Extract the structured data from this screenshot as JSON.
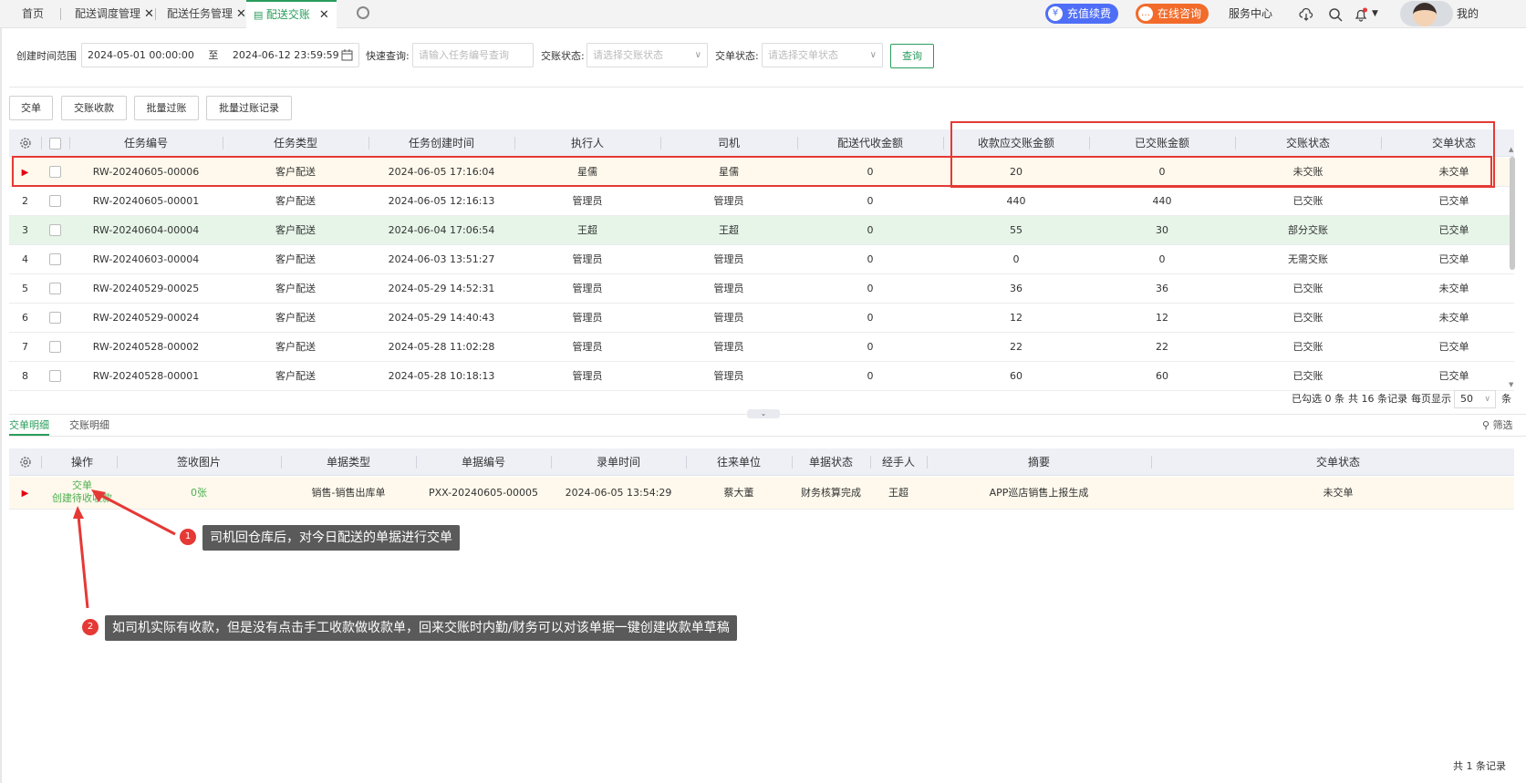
{
  "tabs": [
    {
      "label": "首页"
    },
    {
      "label": "配送调度管理"
    },
    {
      "label": "配送任务管理"
    },
    {
      "label": "配送交账"
    }
  ],
  "header": {
    "recharge": "充值续费",
    "consult": "在线咨询",
    "service": "服务中心",
    "user": "我的"
  },
  "filters": {
    "date_label": "创建时间范围",
    "date_start": "2024-05-01 00:00:00",
    "date_to": "至",
    "date_end": "2024-06-12 23:59:59",
    "quick_label": "快速查询:",
    "quick_placeholder": "请输入任务编号查询",
    "account_status_label": "交账状态:",
    "account_status_placeholder": "请选择交账状态",
    "order_status_label": "交单状态:",
    "order_status_placeholder": "请选择交单状态",
    "query": "查询"
  },
  "actions": [
    "交单",
    "交账收款",
    "批量过账",
    "批量过账记录"
  ],
  "table": {
    "columns": [
      "任务编号",
      "任务类型",
      "任务创建时间",
      "执行人",
      "司机",
      "配送代收金额",
      "收款应交账金额",
      "已交账金额",
      "交账状态",
      "交单状态"
    ],
    "rows": [
      {
        "idx": "",
        "id": "RW-20240605-00006",
        "type": "客户配送",
        "time": "2024-06-05 17:16:04",
        "exec": "星儒",
        "driver": "星儒",
        "cod": "0",
        "due": "20",
        "paid": "0",
        "acc": "未交账",
        "ord": "未交单"
      },
      {
        "idx": "2",
        "id": "RW-20240605-00001",
        "type": "客户配送",
        "time": "2024-06-05 12:16:13",
        "exec": "管理员",
        "driver": "管理员",
        "cod": "0",
        "due": "440",
        "paid": "440",
        "acc": "已交账",
        "ord": "已交单"
      },
      {
        "idx": "3",
        "id": "RW-20240604-00004",
        "type": "客户配送",
        "time": "2024-06-04 17:06:54",
        "exec": "王超",
        "driver": "王超",
        "cod": "0",
        "due": "55",
        "paid": "30",
        "acc": "部分交账",
        "ord": "已交单"
      },
      {
        "idx": "4",
        "id": "RW-20240603-00004",
        "type": "客户配送",
        "time": "2024-06-03 13:51:27",
        "exec": "管理员",
        "driver": "管理员",
        "cod": "0",
        "due": "0",
        "paid": "0",
        "acc": "无需交账",
        "ord": "已交单"
      },
      {
        "idx": "5",
        "id": "RW-20240529-00025",
        "type": "客户配送",
        "time": "2024-05-29 14:52:31",
        "exec": "管理员",
        "driver": "管理员",
        "cod": "0",
        "due": "36",
        "paid": "36",
        "acc": "已交账",
        "ord": "未交单"
      },
      {
        "idx": "6",
        "id": "RW-20240529-00024",
        "type": "客户配送",
        "time": "2024-05-29 14:40:43",
        "exec": "管理员",
        "driver": "管理员",
        "cod": "0",
        "due": "12",
        "paid": "12",
        "acc": "已交账",
        "ord": "未交单"
      },
      {
        "idx": "7",
        "id": "RW-20240528-00002",
        "type": "客户配送",
        "time": "2024-05-28 11:02:28",
        "exec": "管理员",
        "driver": "管理员",
        "cod": "0",
        "due": "22",
        "paid": "22",
        "acc": "已交账",
        "ord": "已交单"
      },
      {
        "idx": "8",
        "id": "RW-20240528-00001",
        "type": "客户配送",
        "time": "2024-05-28 10:18:13",
        "exec": "管理员",
        "driver": "管理员",
        "cod": "0",
        "due": "60",
        "paid": "60",
        "acc": "已交账",
        "ord": "已交单"
      }
    ]
  },
  "pagination": {
    "selected": "已勾选 0 条",
    "total": "共 16 条记录",
    "per_page_label": "每页显示",
    "per_page": "50",
    "unit": "条"
  },
  "subtabs": [
    "交单明细",
    "交账明细"
  ],
  "filter_btn": "筛选",
  "detail": {
    "columns": [
      "操作",
      "签收图片",
      "单据类型",
      "单据编号",
      "录单时间",
      "往来单位",
      "单据状态",
      "经手人",
      "摘要",
      "交单状态"
    ],
    "row": {
      "op1": "交单",
      "op2": "创建待收收款",
      "img": "0张",
      "type": "销售-销售出库单",
      "no": "PXX-20240605-00005",
      "time": "2024-06-05 13:54:29",
      "partner": "蔡大董",
      "state": "财务核算完成",
      "handler": "王超",
      "summary": "APP巡店销售上报生成",
      "ord": "未交单"
    },
    "total": "共 1 条记录"
  },
  "annotations": [
    {
      "n": "1",
      "text": "司机回仓库后，对今日配送的单据进行交单"
    },
    {
      "n": "2",
      "text": "如司机实际有收款，但是没有点击手工收款做收款单，回来交账时内勤/财务可以对该单据一键创建收款单草稿"
    }
  ],
  "colors": {
    "accent": "#2a9d5c",
    "highlight": "#e53935",
    "recharge": "#4f6ef7",
    "consult": "#f26b2a"
  }
}
